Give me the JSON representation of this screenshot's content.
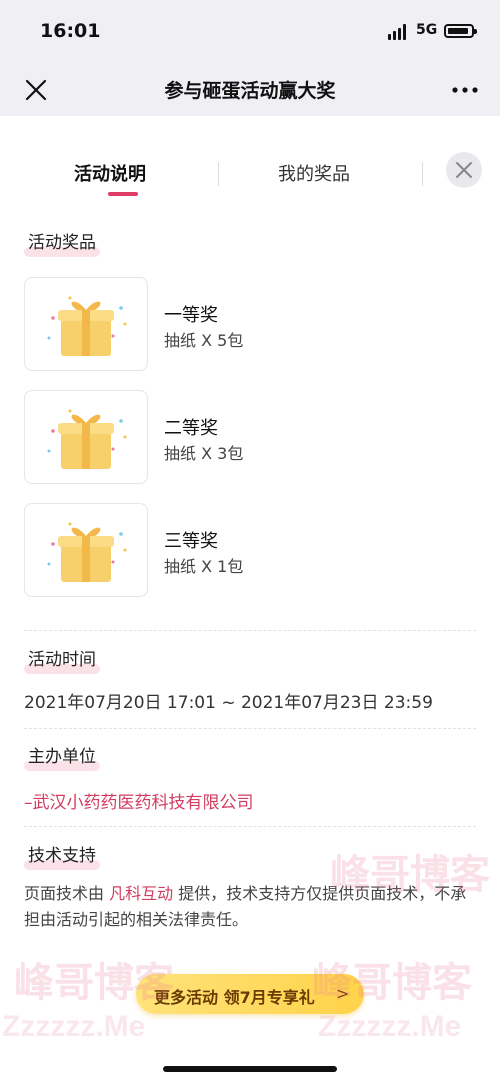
{
  "status_bar": {
    "time": "16:01",
    "network": "5G"
  },
  "nav": {
    "title": "参与砸蛋活动赢大奖"
  },
  "tabs": [
    {
      "label": "活动说明"
    },
    {
      "label": "我的奖品"
    }
  ],
  "sections": {
    "prizes_title": "活动奖品",
    "time_title": "活动时间",
    "organizer_title": "主办单位",
    "support_title": "技术支持"
  },
  "prizes": [
    {
      "name": "一等奖",
      "desc": "抽纸 X 5包"
    },
    {
      "name": "二等奖",
      "desc": "抽纸 X 3包"
    },
    {
      "name": "三等奖",
      "desc": "抽纸 X 1包"
    }
  ],
  "activity_time": "2021年07月20日 17:01 ~ 2021年07月23日 23:59",
  "organizer": "–武汉小药药医药科技有限公司",
  "support": {
    "prefix": "页面技术由 ",
    "link": "凡科互动",
    "suffix": " 提供，技术支持方仅提供页面技术，不承担由活动引起的相关法律责任。"
  },
  "promo": {
    "label": "更多活动 领7月专享礼",
    "chevron": ">"
  },
  "watermark": {
    "cn": "峰哥博客",
    "latin": "Zzzzzz.Me"
  },
  "colors": {
    "accent": "#e03d66",
    "link": "#d23c60",
    "promo": "#ffd34a"
  }
}
